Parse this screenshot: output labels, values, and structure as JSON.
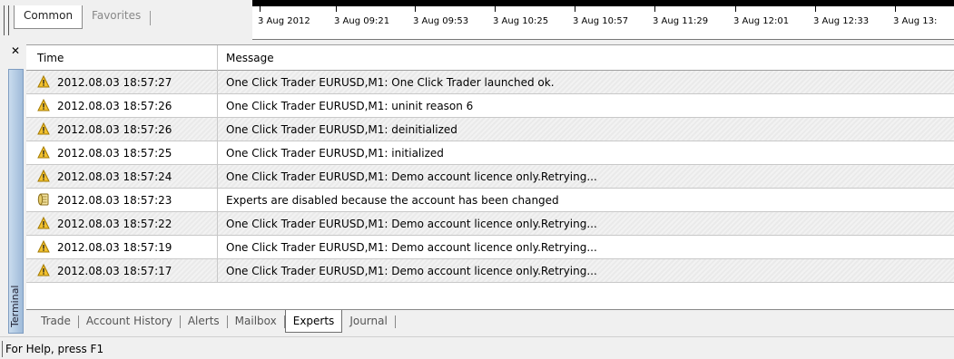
{
  "top_nav": {
    "tabs": [
      {
        "label": "Common",
        "active": true
      },
      {
        "label": "Favorites",
        "active": false
      }
    ]
  },
  "timeline": {
    "labels": [
      "3 Aug 2012",
      "3 Aug 09:21",
      "3 Aug 09:53",
      "3 Aug 10:25",
      "3 Aug 10:57",
      "3 Aug 11:29",
      "3 Aug 12:01",
      "3 Aug 12:33",
      "3 Aug 13:"
    ]
  },
  "terminal": {
    "close_icon": "close-icon",
    "side_label": "Terminal",
    "columns": {
      "time": "Time",
      "message": "Message"
    },
    "rows": [
      {
        "icon": "warning-icon",
        "time": "2012.08.03 18:57:27",
        "message": "One Click Trader EURUSD,M1: One Click Trader launched ok."
      },
      {
        "icon": "warning-icon",
        "time": "2012.08.03 18:57:26",
        "message": "One Click Trader EURUSD,M1: uninit reason 6"
      },
      {
        "icon": "warning-icon",
        "time": "2012.08.03 18:57:26",
        "message": "One Click Trader EURUSD,M1: deinitialized"
      },
      {
        "icon": "warning-icon",
        "time": "2012.08.03 18:57:25",
        "message": "One Click Trader EURUSD,M1: initialized"
      },
      {
        "icon": "warning-icon",
        "time": "2012.08.03 18:57:24",
        "message": "One Click Trader EURUSD,M1: Demo account licence only.Retrying..."
      },
      {
        "icon": "scroll-icon",
        "time": "2012.08.03 18:57:23",
        "message": "Experts are disabled because the account has been changed"
      },
      {
        "icon": "warning-icon",
        "time": "2012.08.03 18:57:22",
        "message": "One Click Trader EURUSD,M1: Demo account licence only.Retrying..."
      },
      {
        "icon": "warning-icon",
        "time": "2012.08.03 18:57:19",
        "message": "One Click Trader EURUSD,M1: Demo account licence only.Retrying..."
      },
      {
        "icon": "warning-icon",
        "time": "2012.08.03 18:57:17",
        "message": "One Click Trader EURUSD,M1: Demo account licence only.Retrying..."
      }
    ],
    "tabs": [
      {
        "label": "Trade",
        "active": false
      },
      {
        "label": "Account History",
        "active": false
      },
      {
        "label": "Alerts",
        "active": false
      },
      {
        "label": "Mailbox",
        "active": false
      },
      {
        "label": "Experts",
        "active": true
      },
      {
        "label": "Journal",
        "active": false
      }
    ]
  },
  "statusbar": {
    "text": "For Help, press F1"
  },
  "colors": {
    "warning": "#f0c020",
    "sidebar": "#9fbbd9"
  }
}
